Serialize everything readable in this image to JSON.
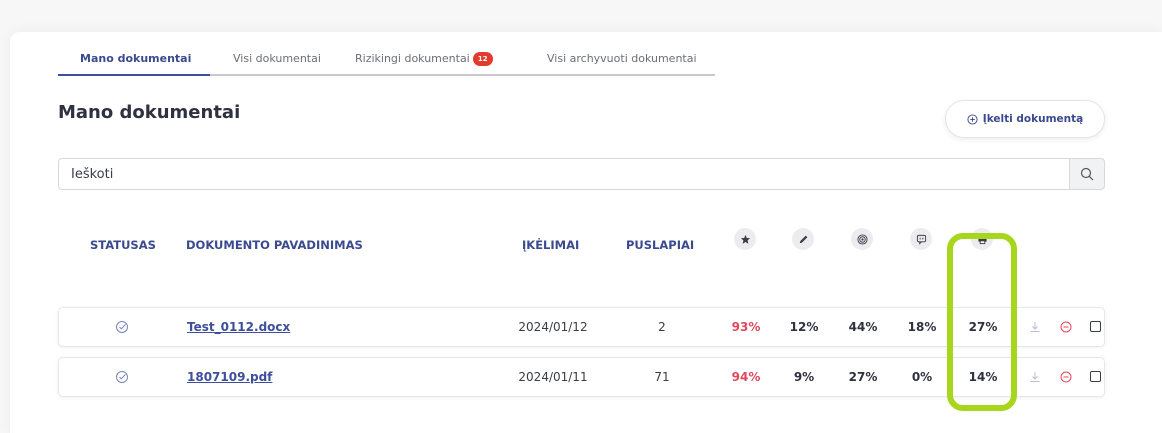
{
  "tabs": [
    {
      "label": "Mano dokumentai",
      "active": true
    },
    {
      "label": "Visi dokumentai",
      "active": false
    },
    {
      "label": "Rizikingi dokumentai",
      "badge": "12",
      "active": false
    },
    {
      "label": "Visi archyvuoti dokumentai",
      "active": false
    }
  ],
  "page_title": "Mano dokumentai",
  "upload_button": {
    "label": "Įkelti dokumentą",
    "icon": "plus-circle-icon"
  },
  "search": {
    "placeholder": "Ieškoti",
    "value": "",
    "icon": "search-icon"
  },
  "columns": {
    "status": "STATUSAS",
    "name": "DOKUMENTO PAVADINIMAS",
    "uploads": "ĮKĖLIMAI",
    "pages": "PUSLAPIAI",
    "metric_icons": [
      "star-icon",
      "pen-icon",
      "target-icon",
      "comment-icon",
      "printer-icon"
    ]
  },
  "rows": [
    {
      "status_icon": "check-circle-icon",
      "name": "Test_0112.docx",
      "date": "2024/01/12",
      "pages": "2",
      "m1": "93%",
      "m2": "12%",
      "m3": "44%",
      "m4": "18%",
      "m5": "27%"
    },
    {
      "status_icon": "check-circle-icon",
      "name": "1807109.pdf",
      "date": "2024/01/11",
      "pages": "71",
      "m1": "94%",
      "m2": "9%",
      "m3": "27%",
      "m4": "0%",
      "m5": "14%"
    }
  ],
  "colors": {
    "accent": "#3e4e9c",
    "danger": "#e0485b",
    "badge": "#e23b2e",
    "highlight": "#a8d61c"
  }
}
